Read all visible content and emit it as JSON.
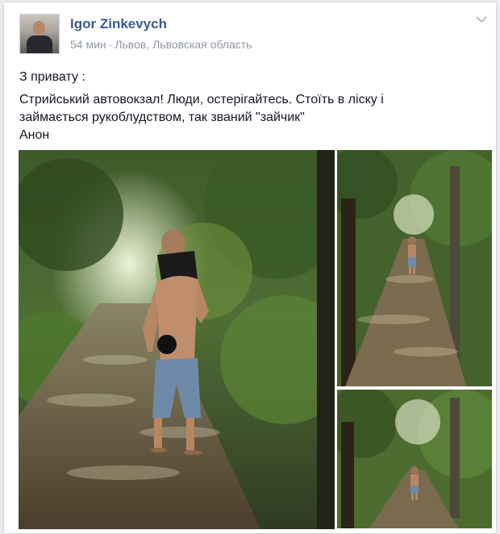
{
  "post": {
    "author": "Igor Zinkevych",
    "time": "54 мин",
    "separator": "·",
    "location": "Львов, Львовская область",
    "lines": [
      "З привату :",
      "Стрийський автовокзал! Люди, остерігайтесь. Стоїть в ліску і",
      "займається рукоблудством, так званий \"зайчик\"",
      "Анон"
    ]
  },
  "icons": {
    "menu": "chevron-down-icon"
  },
  "colors": {
    "author": "#3b5998",
    "meta": "#9197a3",
    "text": "#141823",
    "background": "#e9ebee"
  }
}
